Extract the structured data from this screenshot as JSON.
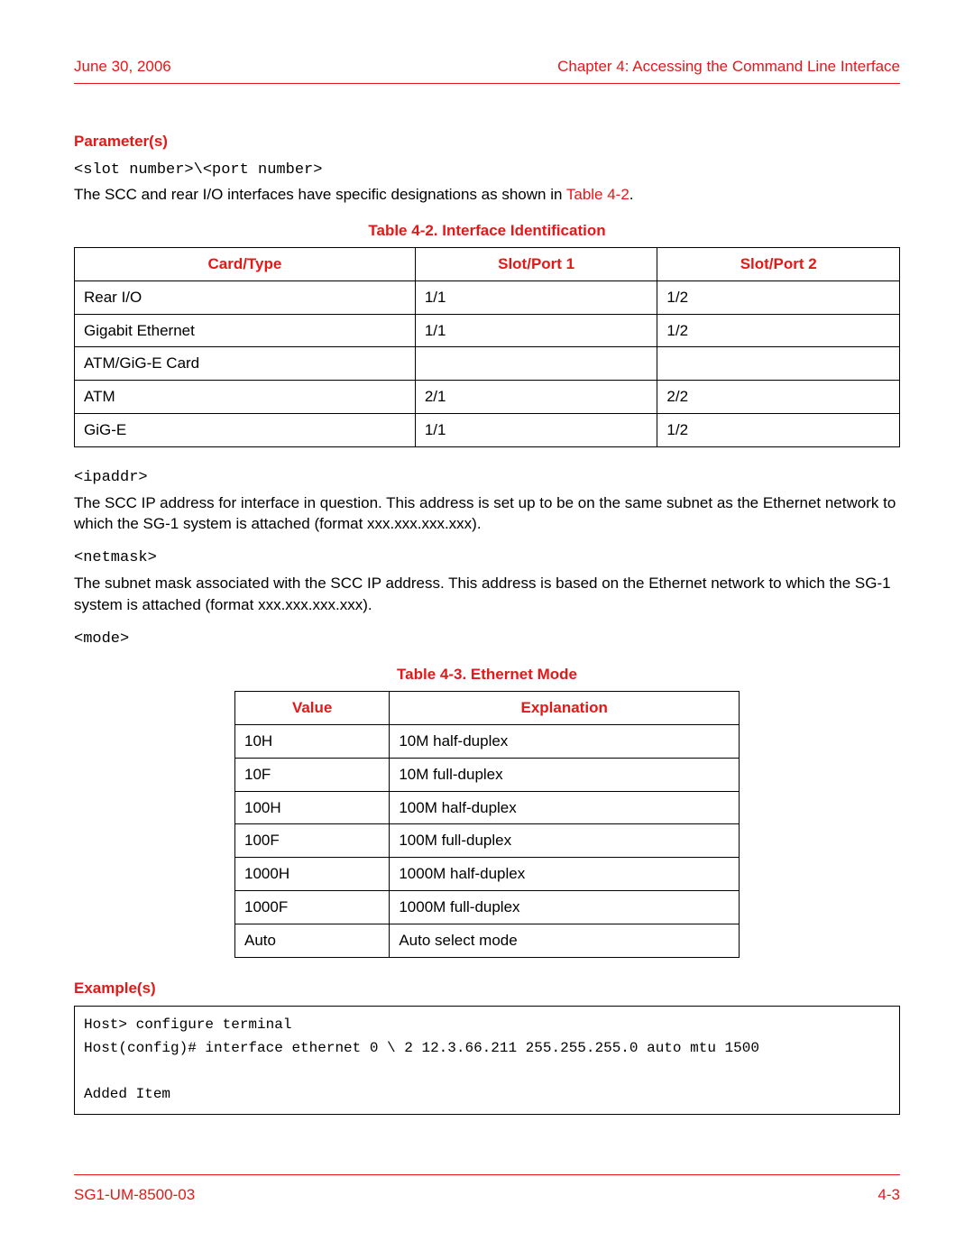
{
  "header": {
    "date": "June 30, 2006",
    "chapter": "Chapter 4: Accessing the Command Line Interface"
  },
  "sections": {
    "parameters_heading": "Parameter(s)",
    "slot_port_syntax": "<slot number>\\<port number>",
    "intro_text_1": "The SCC and rear I/O interfaces have specific designations as shown in ",
    "table_ref_1": "Table 4-2",
    "intro_text_1_end": ".",
    "ipaddr_label": "<ipaddr>",
    "ipaddr_desc": "The SCC IP address for interface in question. This address is set up to be on the same subnet as the Ethernet network to which the SG-1 system is attached (format xxx.xxx.xxx.xxx).",
    "netmask_label": "<netmask>",
    "netmask_desc": "The subnet mask associated with the SCC IP address. This address is based on the Ethernet network to which the SG-1 system is attached (format xxx.xxx.xxx.xxx).",
    "mode_label": "<mode>",
    "examples_heading": "Example(s)"
  },
  "table1": {
    "title": "Table 4-2. Interface Identification",
    "headers": [
      "Card/Type",
      "Slot/Port 1",
      "Slot/Port 2"
    ],
    "rows": [
      [
        "Rear I/O",
        "1/1",
        "1/2"
      ],
      [
        "Gigabit Ethernet",
        "1/1",
        "1/2"
      ],
      [
        "ATM/GiG-E Card",
        "",
        ""
      ],
      [
        "ATM",
        "2/1",
        "2/2"
      ],
      [
        "GiG-E",
        "1/1",
        "1/2"
      ]
    ]
  },
  "table2": {
    "title": "Table 4-3. Ethernet Mode",
    "headers": [
      "Value",
      "Explanation"
    ],
    "rows": [
      [
        "10H",
        "10M half-duplex"
      ],
      [
        "10F",
        "10M full-duplex"
      ],
      [
        "100H",
        "100M half-duplex"
      ],
      [
        "100F",
        "100M full-duplex"
      ],
      [
        "1000H",
        "1000M half-duplex"
      ],
      [
        "1000F",
        "1000M full-duplex"
      ],
      [
        "Auto",
        "Auto select mode"
      ]
    ]
  },
  "example_code": "Host> configure terminal\nHost(config)# interface ethernet 0 \\ 2 12.3.66.211 255.255.255.0 auto mtu 1500\n\nAdded Item",
  "footer": {
    "doc_id": "SG1-UM-8500-03",
    "page": "4-3"
  }
}
